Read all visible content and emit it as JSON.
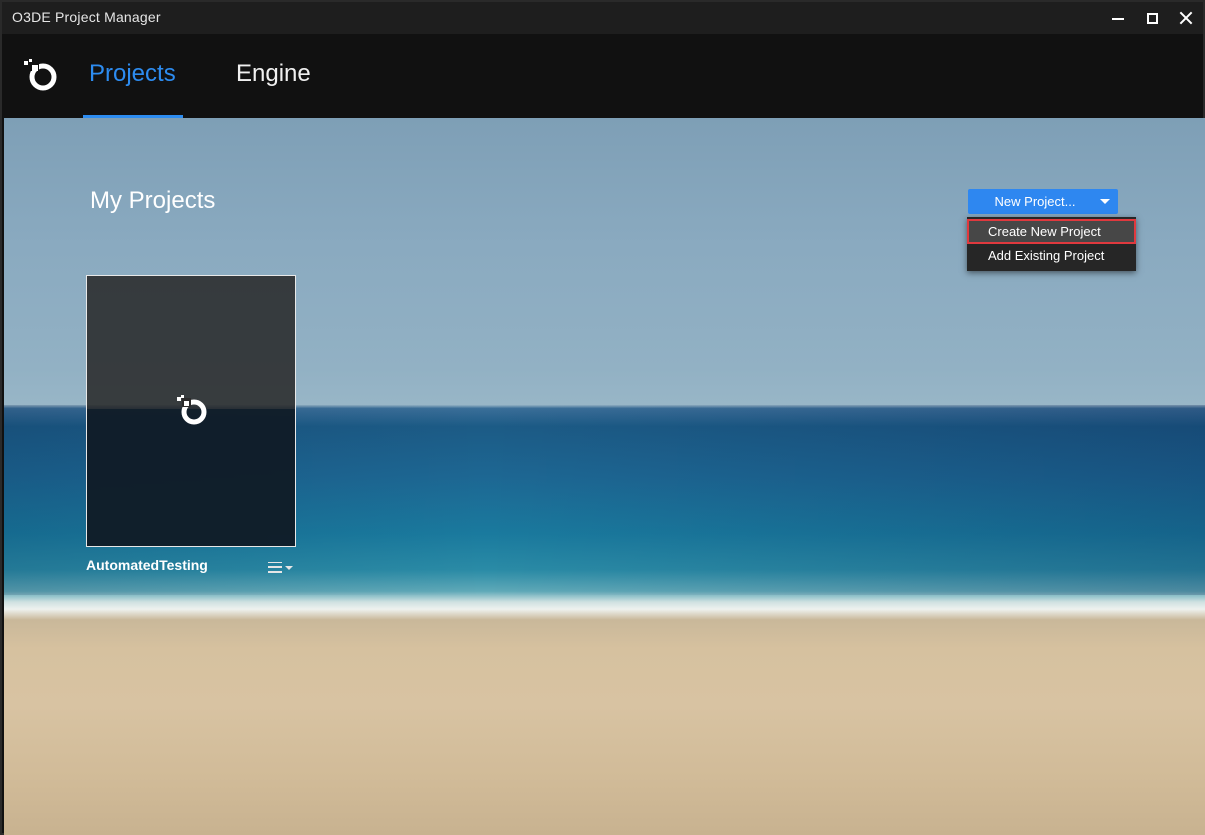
{
  "window": {
    "title": "O3DE Project Manager",
    "controls": [
      "minimize-icon",
      "maximize-icon",
      "close-icon"
    ]
  },
  "nav": {
    "logo_icon": "o3de-logo-icon",
    "tabs": [
      {
        "label": "Projects",
        "active": true
      },
      {
        "label": "Engine",
        "active": false
      }
    ],
    "accent_color": "#2d8cf0"
  },
  "main": {
    "heading": "My Projects",
    "new_project_button": {
      "label": "New Project...",
      "color": "#2e87f0",
      "dropdown_icon": "chevron-down-icon"
    },
    "dropdown": {
      "items": [
        {
          "label": "Create New Project",
          "highlighted": true
        },
        {
          "label": "Add Existing Project",
          "highlighted": false
        }
      ],
      "highlight_color": "#e0393e"
    },
    "projects": [
      {
        "name": "AutomatedTesting",
        "thumbnail_icon": "o3de-logo-icon",
        "menu_icon": "hamburger-menu-icon"
      }
    ]
  }
}
